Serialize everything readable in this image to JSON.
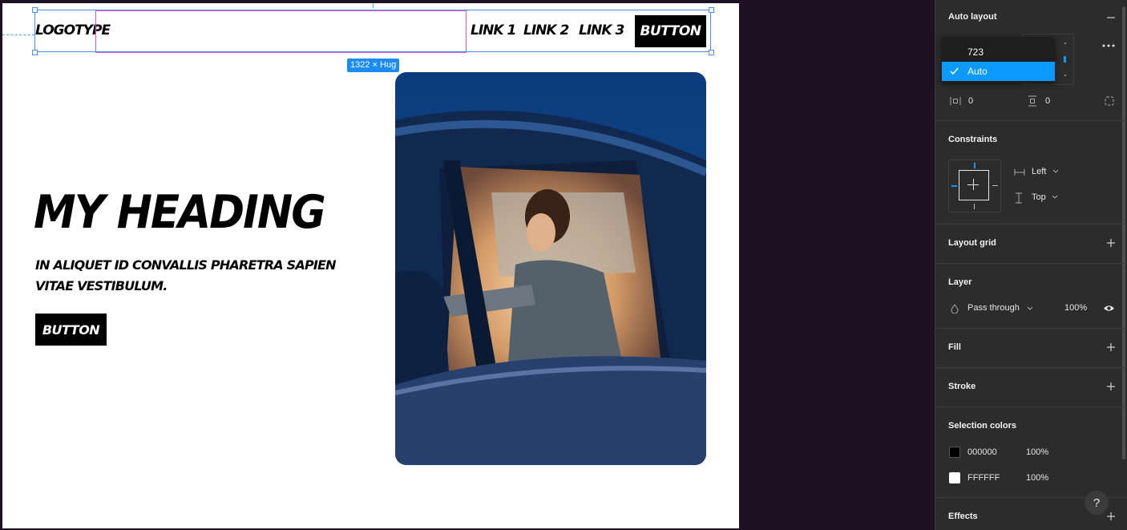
{
  "canvas": {
    "size_badge": "1322 × Hug",
    "nav": {
      "logotype": "LOGOTYPE",
      "links": [
        "LINK 1",
        "LINK 2",
        "LINK 3"
      ],
      "button": "BUTTON"
    },
    "hero": {
      "heading": "MY HEADING",
      "subheading": "IN ALIQUET ID CONVALLIS PHARETRA SAPIEN VITAE VESTIBULUM.",
      "button": "BUTTON"
    }
  },
  "panel": {
    "auto_layout": {
      "title": "Auto layout",
      "dropdown_options": [
        "723",
        "Auto"
      ],
      "selected": "Auto",
      "padding_horizontal": "0",
      "padding_vertical": "0"
    },
    "constraints": {
      "title": "Constraints",
      "horizontal": "Left",
      "vertical": "Top"
    },
    "layout_grid": {
      "title": "Layout grid"
    },
    "layer": {
      "title": "Layer",
      "blend_mode": "Pass through",
      "opacity": "100%"
    },
    "fill": {
      "title": "Fill"
    },
    "stroke": {
      "title": "Stroke"
    },
    "selection_colors": {
      "title": "Selection colors",
      "colors": [
        {
          "hex": "000000",
          "opacity": "100%",
          "swatch": "#000000"
        },
        {
          "hex": "FFFFFF",
          "opacity": "100%",
          "swatch": "#FFFFFF"
        }
      ]
    },
    "effects": {
      "title": "Effects"
    },
    "help": "?"
  },
  "colors": {
    "canvas_bg": "#1e1124",
    "selection_blue": "#4b8ff7",
    "spacer_pink": "#e157c9",
    "accent": "#0d99ff",
    "panel_bg": "#2c2c2c"
  }
}
